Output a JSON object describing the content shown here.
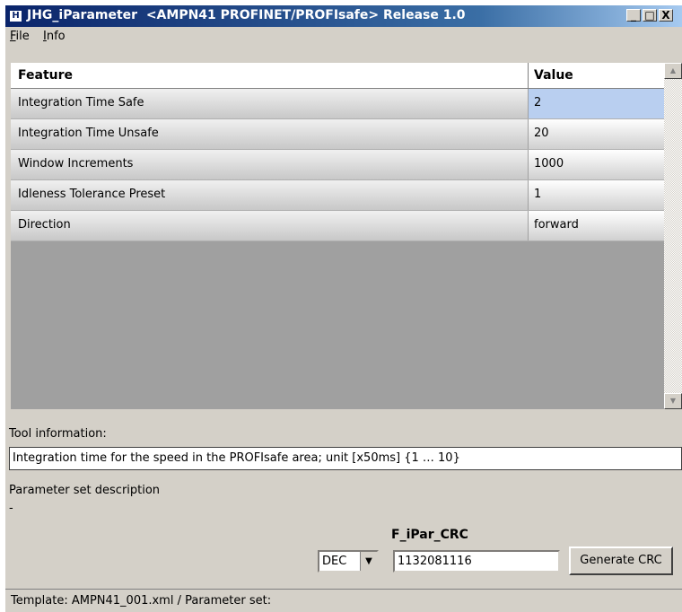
{
  "window": {
    "title": "JHG_iParameter  <AMPN41 PROFINET/PROFIsafe> Release 1.0",
    "buttons": [
      "_",
      "□",
      "X"
    ]
  },
  "menu": {
    "file": {
      "accel": "F",
      "rest": "ile"
    },
    "info": {
      "accel": "I",
      "rest": "nfo"
    }
  },
  "table": {
    "columns": [
      "Feature",
      "Value"
    ],
    "rows": [
      {
        "feature": "Integration Time Safe",
        "value": "2"
      },
      {
        "feature": "Integration Time Unsafe",
        "value": "20"
      },
      {
        "feature": "Window Increments",
        "value": "1000"
      },
      {
        "feature": "Idleness Tolerance Preset",
        "value": "1"
      },
      {
        "feature": "Direction",
        "value": "forward"
      }
    ]
  },
  "tool_info": {
    "label": "Tool information:",
    "text": "Integration time for the speed in the PROFIsafe area; unit [x50ms] {1 … 10}"
  },
  "param_set": {
    "label": "Parameter set description",
    "value": "-"
  },
  "crc": {
    "label": "F_iPar_CRC",
    "format": "DEC",
    "value": "1132081116",
    "button": "Generate CRC"
  },
  "status": {
    "text": "Template: AMPN41_001.xml  /  Parameter set:"
  }
}
